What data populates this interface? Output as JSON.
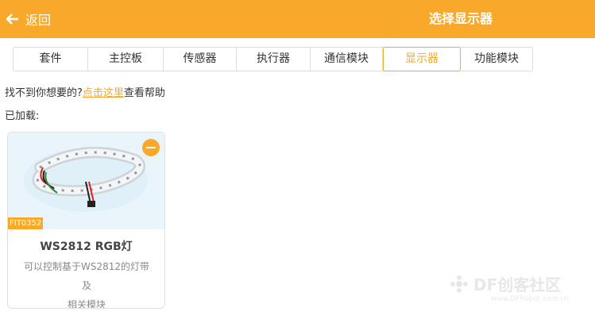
{
  "header": {
    "back_label": "返回",
    "title": "选择显示器"
  },
  "tabs": [
    {
      "label": "套件"
    },
    {
      "label": "主控板"
    },
    {
      "label": "传感器"
    },
    {
      "label": "执行器"
    },
    {
      "label": "通信模块"
    },
    {
      "label": "显示器",
      "active": true
    },
    {
      "label": "功能模块"
    }
  ],
  "help": {
    "prefix": "找不到你想要的?",
    "link": "点击这里",
    "suffix": "查看帮助"
  },
  "loaded_label": "已加载:",
  "card": {
    "sku": "FIT0352",
    "name": "WS2812 RGB灯",
    "desc_line1": "可以控制基于WS2812的灯带及",
    "desc_line2": "相关模块"
  },
  "watermark": {
    "text": "DF创客社区",
    "url": "www.DFRobot.com.cn"
  },
  "colors": {
    "accent": "#f8a92a"
  }
}
